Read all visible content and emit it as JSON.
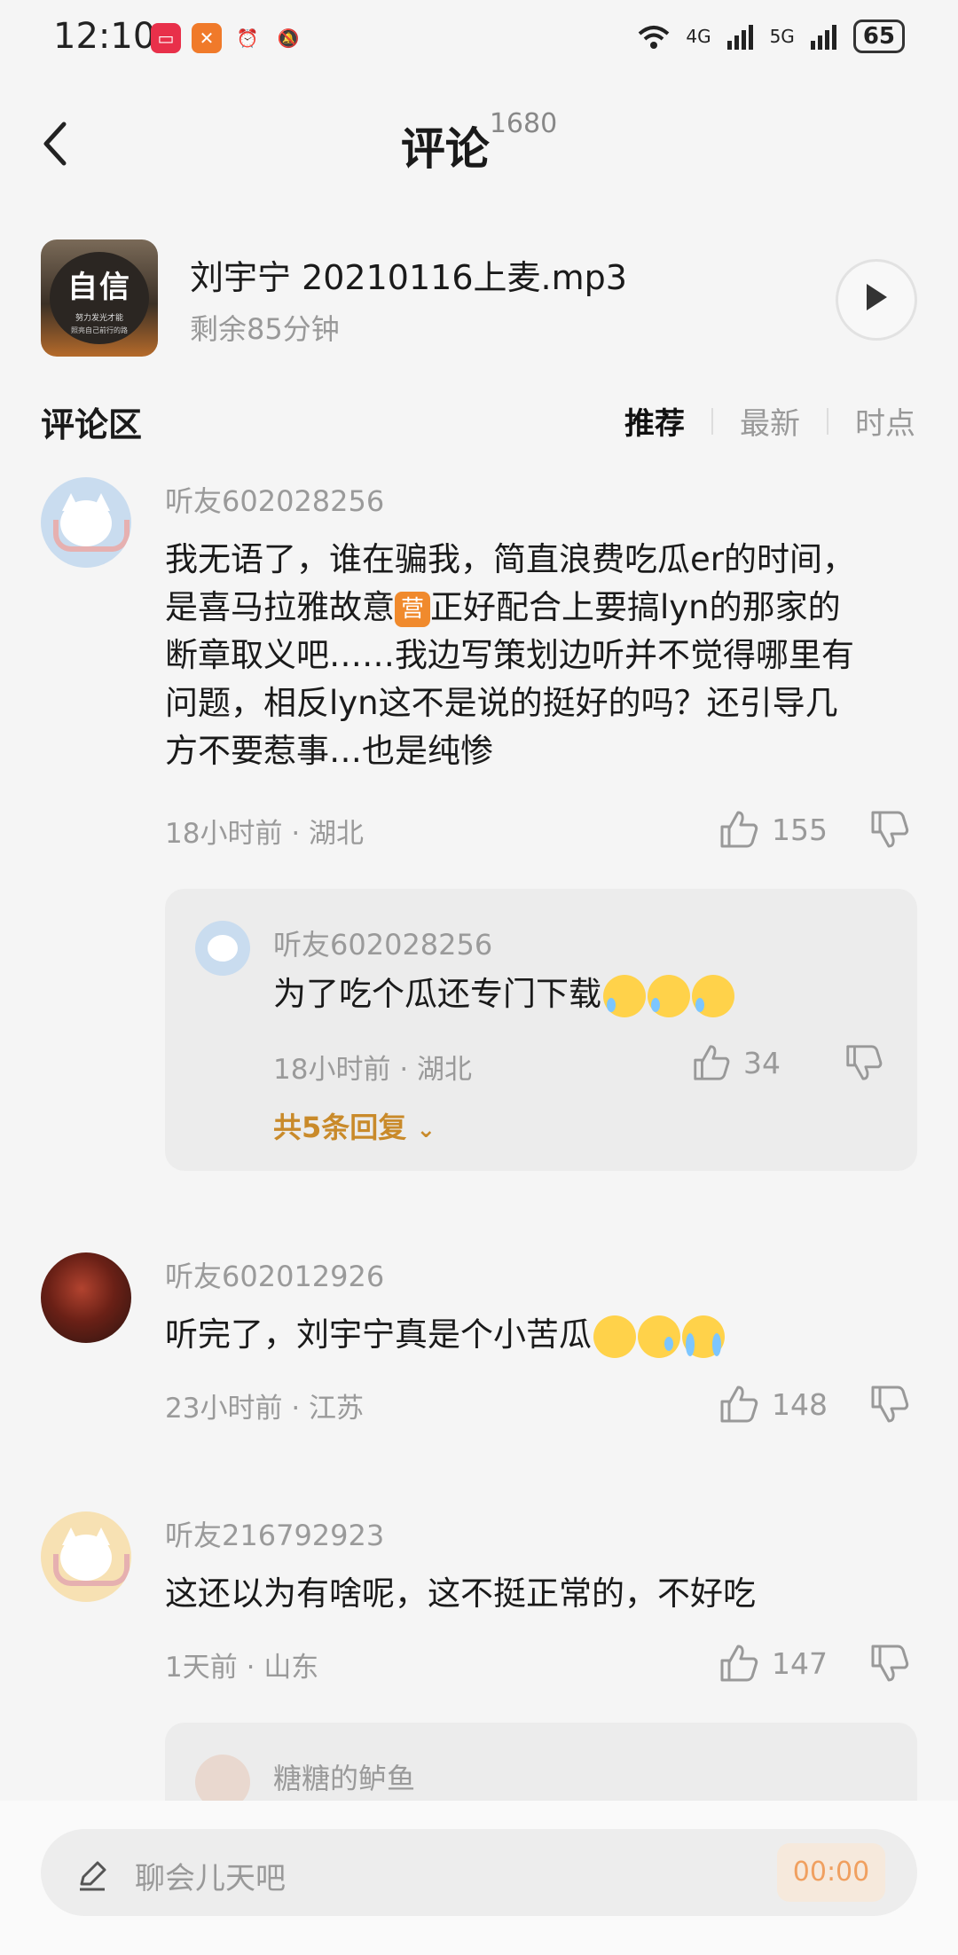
{
  "status_bar": {
    "time": "12:10",
    "battery": "65",
    "net1": "4G",
    "net2": "5G"
  },
  "header": {
    "title": "评论",
    "count": "1680"
  },
  "audio": {
    "title": "刘宇宁 20210116上麦.mp3",
    "subtitle": "剩余85分钟",
    "cover_text": "自信",
    "cover_sub": "努力发光才能",
    "cover_sub2": "照亮自己前行的路"
  },
  "section": {
    "title": "评论区",
    "tabs": [
      "推荐",
      "最新",
      "时点"
    ]
  },
  "comments": [
    {
      "user": "听友602028256",
      "lines": [
        "我无语了，谁在骗我，简直浪费吃瓜er的时间，",
        "是喜马拉雅故意",
        "正好配合上要搞lyn的那家的",
        "断章取义吧……我边写策划边听并不觉得哪里有",
        "问题，相反lyn这不是说的挺好的吗？还引导几",
        "方不要惹事…也是纯惨"
      ],
      "badge": "营",
      "time": "18小时前",
      "region": "湖北",
      "likes": "155",
      "reply": {
        "user": "听友602028256",
        "text": "为了吃个瓜还专门下载",
        "time": "18小时前",
        "region": "湖北",
        "likes": "34",
        "more": "共5条回复"
      }
    },
    {
      "user": "听友602012926",
      "text": "听完了，刘宇宁真是个小苦瓜",
      "time": "23小时前",
      "region": "江苏",
      "likes": "148"
    },
    {
      "user": "听友216792923",
      "text": "这还以为有啥呢，这不挺正常的，不好吃",
      "time": "1天前",
      "region": "山东",
      "likes": "147",
      "reply": {
        "user": "糖糖的鲈鱼"
      }
    }
  ],
  "input": {
    "placeholder": "聊会儿天吧",
    "timer": "00:00"
  },
  "sep": "·"
}
